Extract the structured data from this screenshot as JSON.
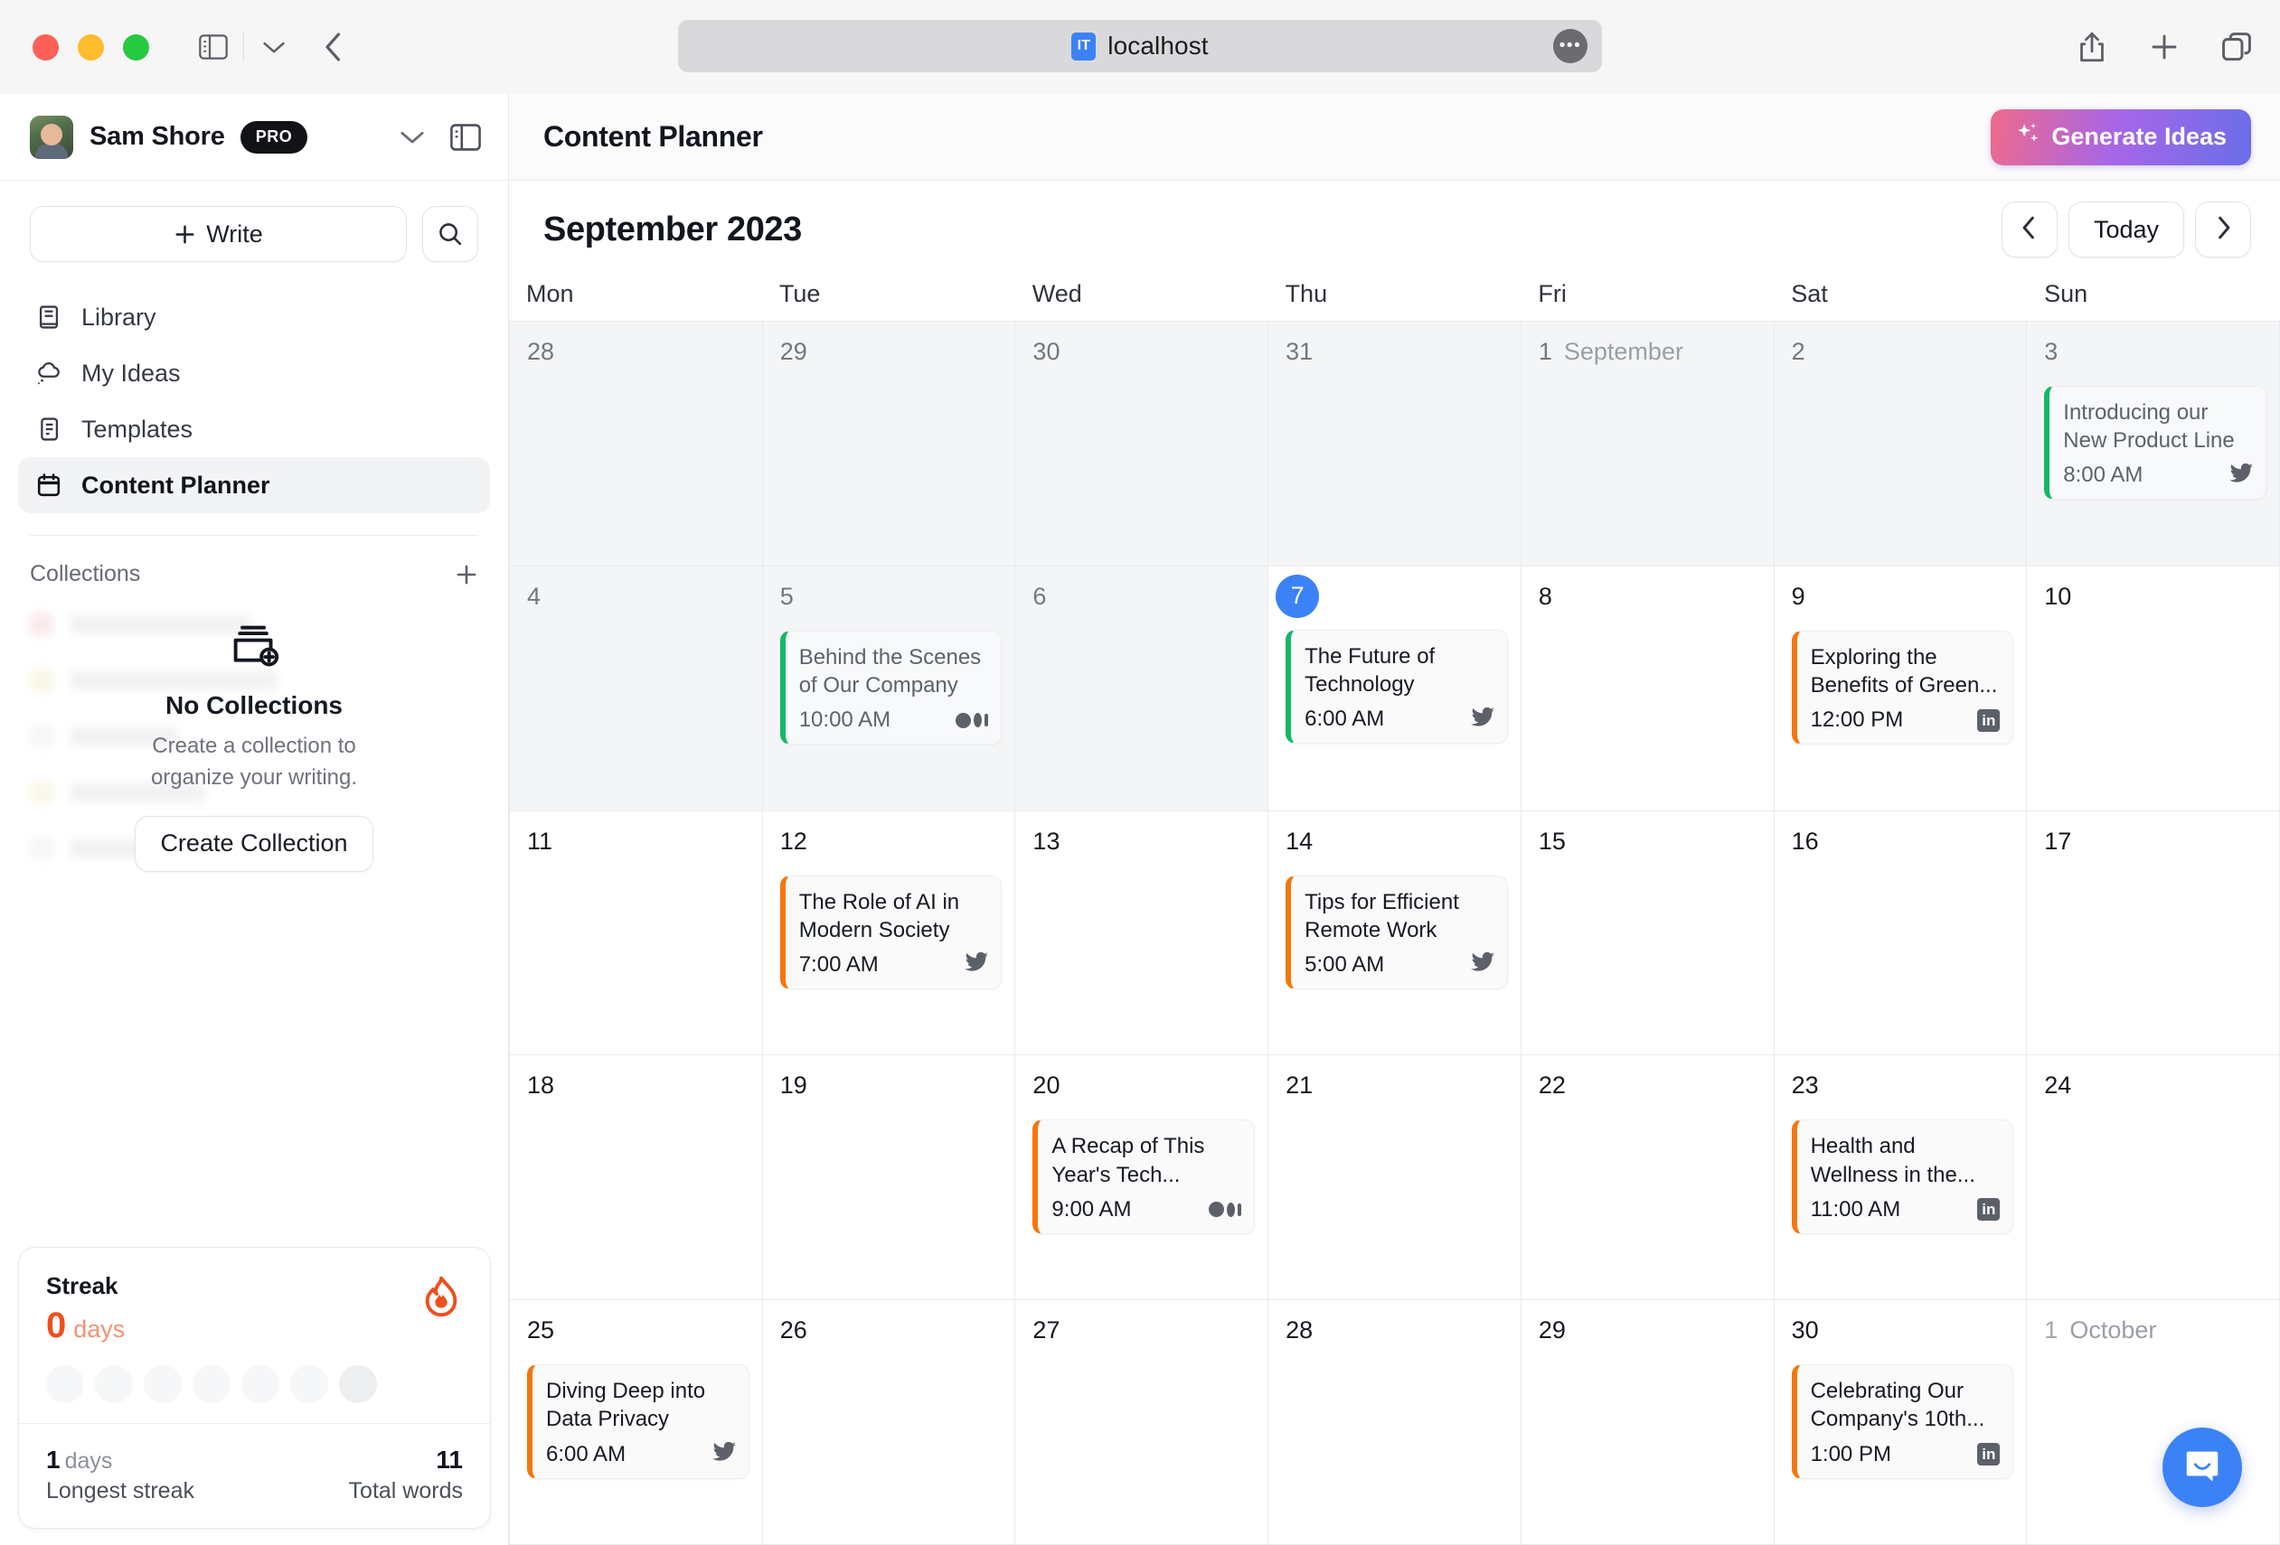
{
  "browser": {
    "url": "localhost",
    "favicon_label": "IT",
    "more_icon": "ellipsis-icon",
    "back_icon": "back-chevron-icon",
    "sidebar_icon": "sidebar-toggle-icon",
    "tab_overview_icon": "tabs-icon",
    "share_icon": "share-icon",
    "new_tab_icon": "plus-icon"
  },
  "sidebar": {
    "user": {
      "name": "Sam Shore",
      "badge": "PRO"
    },
    "write_label": "Write",
    "search_icon": "search-icon",
    "nav": [
      {
        "label": "Library",
        "icon": "book-icon",
        "active": false
      },
      {
        "label": "My Ideas",
        "icon": "cloud-idea-icon",
        "active": false
      },
      {
        "label": "Templates",
        "icon": "template-icon",
        "active": false
      },
      {
        "label": "Content Planner",
        "icon": "calendar-icon",
        "active": true
      }
    ],
    "collections": {
      "title": "Collections",
      "add_icon": "plus-icon",
      "empty_icon": "add-collection-icon",
      "empty_title": "No Collections",
      "empty_subtitle": "Create a collection to organize your writing.",
      "create_button": "Create Collection"
    },
    "streak": {
      "label": "Streak",
      "count": "0",
      "count_unit": "days",
      "flame_icon": "flame-icon",
      "flame_color": "#f04e1c",
      "dots": 7,
      "longest_value": "1",
      "longest_unit": "days",
      "longest_caption": "Longest streak",
      "total_value": "11",
      "total_caption": "Total words"
    }
  },
  "header": {
    "title": "Content Planner",
    "generate_button": "Generate Ideas",
    "generate_icon": "sparkles-icon"
  },
  "calendar": {
    "month_label": "September 2023",
    "today_button": "Today",
    "prev_icon": "chevron-left-icon",
    "next_icon": "chevron-right-icon",
    "weekdays": [
      "Mon",
      "Tue",
      "Wed",
      "Thu",
      "Fri",
      "Sat",
      "Sun"
    ],
    "accent_today": "#3b82f6",
    "accent_green": "#14b866",
    "accent_orange": "#f5760b",
    "days": [
      {
        "num": "28",
        "month_label": "",
        "state": "past",
        "today": false,
        "events": []
      },
      {
        "num": "29",
        "month_label": "",
        "state": "past",
        "today": false,
        "events": []
      },
      {
        "num": "30",
        "month_label": "",
        "state": "past",
        "today": false,
        "events": []
      },
      {
        "num": "31",
        "month_label": "",
        "state": "past",
        "today": false,
        "events": []
      },
      {
        "num": "1",
        "month_label": "September",
        "state": "past",
        "today": false,
        "events": []
      },
      {
        "num": "2",
        "month_label": "",
        "state": "past",
        "today": false,
        "events": []
      },
      {
        "num": "3",
        "month_label": "",
        "state": "past",
        "today": false,
        "events": [
          {
            "title": "Introducing our New Product Line",
            "time": "8:00 AM",
            "platform": "twitter",
            "color": "#14b866"
          }
        ]
      },
      {
        "num": "4",
        "month_label": "",
        "state": "past",
        "today": false,
        "events": []
      },
      {
        "num": "5",
        "month_label": "",
        "state": "past",
        "today": false,
        "events": [
          {
            "title": "Behind the Scenes of Our Company",
            "time": "10:00 AM",
            "platform": "medium",
            "color": "#14b866"
          }
        ]
      },
      {
        "num": "6",
        "month_label": "",
        "state": "past",
        "today": false,
        "events": []
      },
      {
        "num": "7",
        "month_label": "",
        "state": "current",
        "today": true,
        "events": [
          {
            "title": "The Future of Technology",
            "time": "6:00 AM",
            "platform": "twitter",
            "color": "#14b866"
          }
        ]
      },
      {
        "num": "8",
        "month_label": "",
        "state": "current",
        "today": false,
        "events": []
      },
      {
        "num": "9",
        "month_label": "",
        "state": "current",
        "today": false,
        "events": [
          {
            "title": "Exploring the Benefits of Green...",
            "time": "12:00 PM",
            "platform": "linkedin",
            "color": "#f5760b"
          }
        ]
      },
      {
        "num": "10",
        "month_label": "",
        "state": "current",
        "today": false,
        "events": []
      },
      {
        "num": "11",
        "month_label": "",
        "state": "current",
        "today": false,
        "events": []
      },
      {
        "num": "12",
        "month_label": "",
        "state": "current",
        "today": false,
        "events": [
          {
            "title": "The Role of AI in Modern Society",
            "time": "7:00 AM",
            "platform": "twitter",
            "color": "#f5760b"
          }
        ]
      },
      {
        "num": "13",
        "month_label": "",
        "state": "current",
        "today": false,
        "events": []
      },
      {
        "num": "14",
        "month_label": "",
        "state": "current",
        "today": false,
        "events": [
          {
            "title": "Tips for Efficient Remote Work",
            "time": "5:00 AM",
            "platform": "twitter",
            "color": "#f5760b"
          }
        ]
      },
      {
        "num": "15",
        "month_label": "",
        "state": "current",
        "today": false,
        "events": []
      },
      {
        "num": "16",
        "month_label": "",
        "state": "current",
        "today": false,
        "events": []
      },
      {
        "num": "17",
        "month_label": "",
        "state": "current",
        "today": false,
        "events": []
      },
      {
        "num": "18",
        "month_label": "",
        "state": "current",
        "today": false,
        "events": []
      },
      {
        "num": "19",
        "month_label": "",
        "state": "current",
        "today": false,
        "events": []
      },
      {
        "num": "20",
        "month_label": "",
        "state": "current",
        "today": false,
        "events": [
          {
            "title": "A Recap of This Year's Tech...",
            "time": "9:00 AM",
            "platform": "medium",
            "color": "#f5760b"
          }
        ]
      },
      {
        "num": "21",
        "month_label": "",
        "state": "current",
        "today": false,
        "events": []
      },
      {
        "num": "22",
        "month_label": "",
        "state": "current",
        "today": false,
        "events": []
      },
      {
        "num": "23",
        "month_label": "",
        "state": "current",
        "today": false,
        "events": [
          {
            "title": "Health and Wellness in the...",
            "time": "11:00 AM",
            "platform": "linkedin",
            "color": "#f5760b"
          }
        ]
      },
      {
        "num": "24",
        "month_label": "",
        "state": "current",
        "today": false,
        "events": []
      },
      {
        "num": "25",
        "month_label": "",
        "state": "current",
        "today": false,
        "events": [
          {
            "title": "Diving Deep into Data Privacy",
            "time": "6:00 AM",
            "platform": "twitter",
            "color": "#f5760b"
          }
        ]
      },
      {
        "num": "26",
        "month_label": "",
        "state": "current",
        "today": false,
        "events": []
      },
      {
        "num": "27",
        "month_label": "",
        "state": "current",
        "today": false,
        "events": []
      },
      {
        "num": "28",
        "month_label": "",
        "state": "current",
        "today": false,
        "events": []
      },
      {
        "num": "29",
        "month_label": "",
        "state": "current",
        "today": false,
        "events": []
      },
      {
        "num": "30",
        "month_label": "",
        "state": "current",
        "today": false,
        "events": [
          {
            "title": "Celebrating Our Company's 10th...",
            "time": "1:00 PM",
            "platform": "linkedin",
            "color": "#f5760b"
          }
        ]
      },
      {
        "num": "1",
        "month_label": "October",
        "state": "muted",
        "today": false,
        "events": []
      }
    ]
  },
  "intercom": {
    "icon": "chat-bubble-icon"
  }
}
